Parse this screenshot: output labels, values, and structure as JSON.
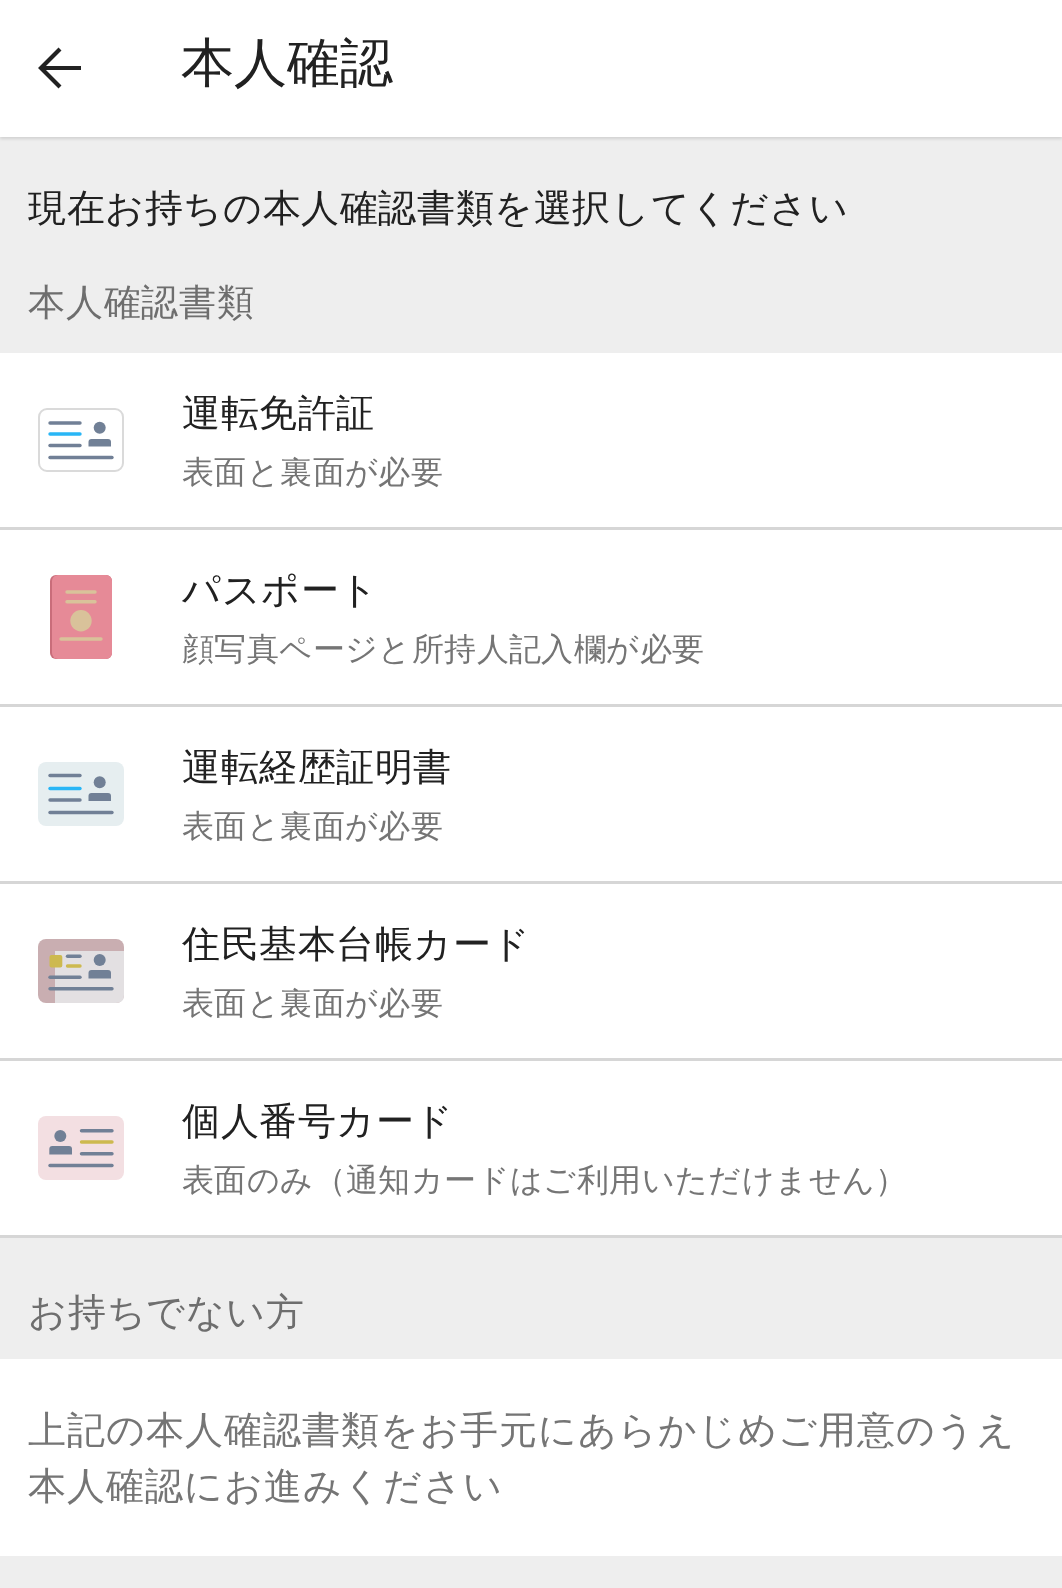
{
  "app_bar": {
    "title": "本人確認"
  },
  "instruction": "現在お持ちの本人確認書類を選択してください",
  "documents": {
    "header": "本人確認書類",
    "items": [
      {
        "kind": "license",
        "title": "運転免許証",
        "subtitle": "表面と裏面が必要"
      },
      {
        "kind": "passport",
        "title": "パスポート",
        "subtitle": "顔写真ページと所持人記入欄が必要"
      },
      {
        "kind": "record",
        "title": "運転経歴証明書",
        "subtitle": "表面と裏面が必要"
      },
      {
        "kind": "resident",
        "title": "住民基本台帳カード",
        "subtitle": "表面と裏面が必要"
      },
      {
        "kind": "number",
        "title": "個人番号カード",
        "subtitle": "表面のみ（通知カードはご利用いただけません）"
      }
    ]
  },
  "no_documents": {
    "header": "お持ちでない方",
    "text": "上記の本人確認書類をお手元にあらかじめご用意のうえ本人確認にお進みください"
  }
}
